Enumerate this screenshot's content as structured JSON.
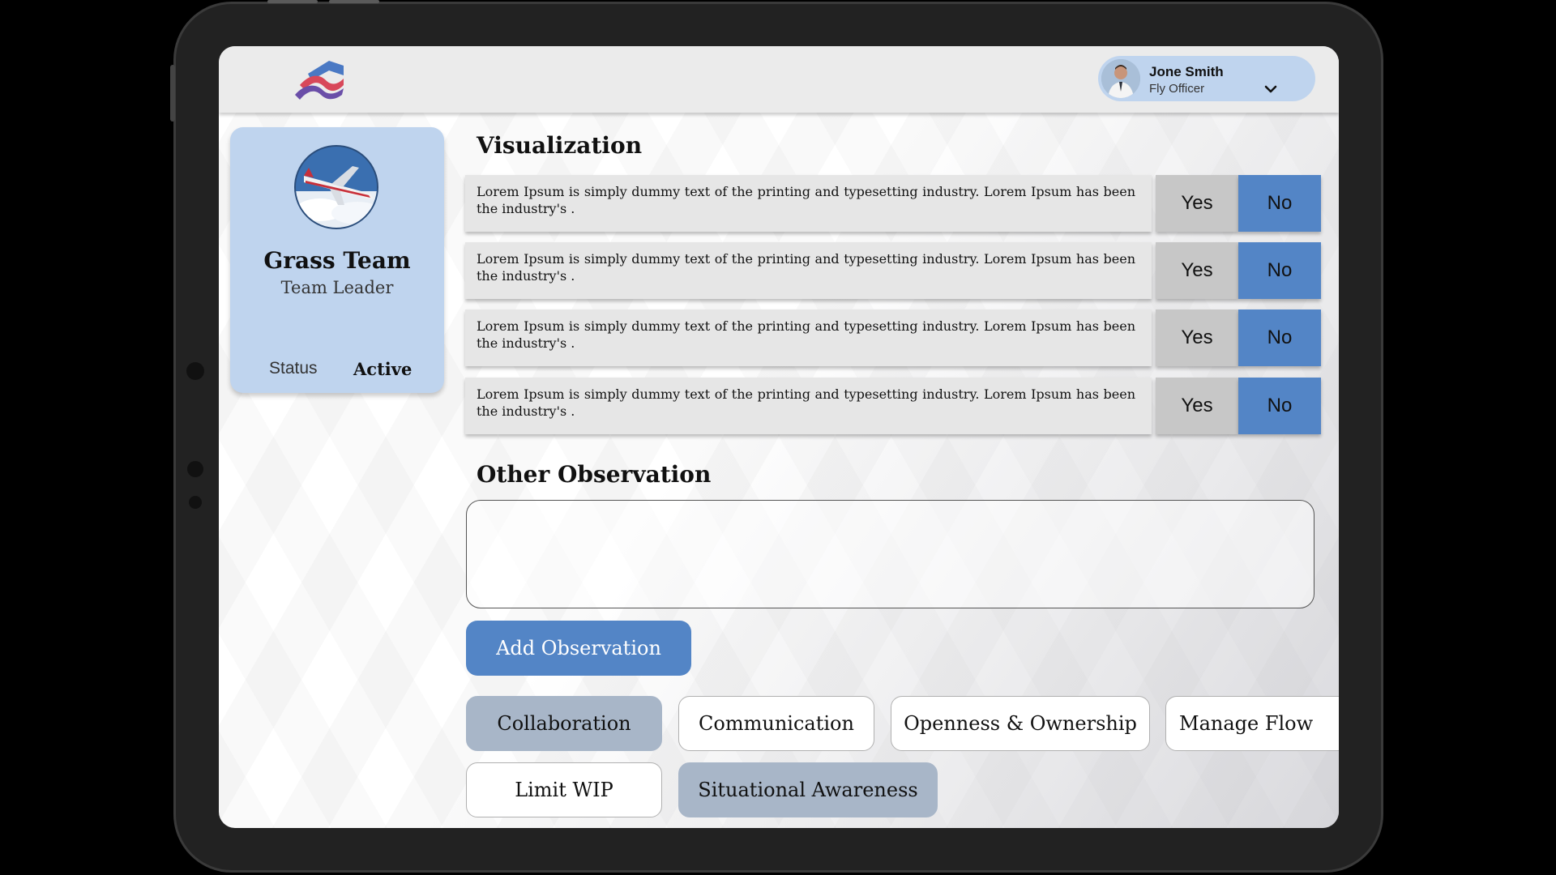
{
  "header": {
    "logo_icon": "wave-logo",
    "user": {
      "name": "Jone Smith",
      "role": "Fly Officer"
    }
  },
  "team": {
    "name": "Grass Team",
    "role": "Team Leader",
    "status_label": "Status",
    "status_value": "Active"
  },
  "visualization": {
    "title": "Visualization",
    "questions": [
      {
        "text": "Lorem Ipsum is simply dummy text of the printing and typesetting industry. Lorem Ipsum has been the industry's .",
        "yes": "Yes",
        "no": "No",
        "selected": "No"
      },
      {
        "text": "Lorem Ipsum is simply dummy text of the printing and typesetting industry. Lorem Ipsum has been the industry's .",
        "yes": "Yes",
        "no": "No",
        "selected": "No"
      },
      {
        "text": "Lorem Ipsum is simply dummy text of the printing and typesetting industry. Lorem Ipsum has been the industry's .",
        "yes": "Yes",
        "no": "No",
        "selected": "No"
      },
      {
        "text": "Lorem Ipsum is simply dummy text of the printing and typesetting industry. Lorem Ipsum has been the industry's .",
        "yes": "Yes",
        "no": "No",
        "selected": "No"
      }
    ]
  },
  "observation": {
    "title": "Other Observation",
    "value": "",
    "add_label": "Add Observation"
  },
  "categories": [
    {
      "label": "Collaboration",
      "selected": true
    },
    {
      "label": "Communication",
      "selected": false
    },
    {
      "label": "Openness & Ownership",
      "selected": false
    },
    {
      "label": "Manage Flow",
      "selected": false
    },
    {
      "label": "Limit WIP",
      "selected": false
    },
    {
      "label": "Situational Awareness",
      "selected": true
    }
  ],
  "colors": {
    "accent": "#5385c6",
    "card": "#bfd4ee",
    "chip_selected": "#a8b6c8"
  }
}
